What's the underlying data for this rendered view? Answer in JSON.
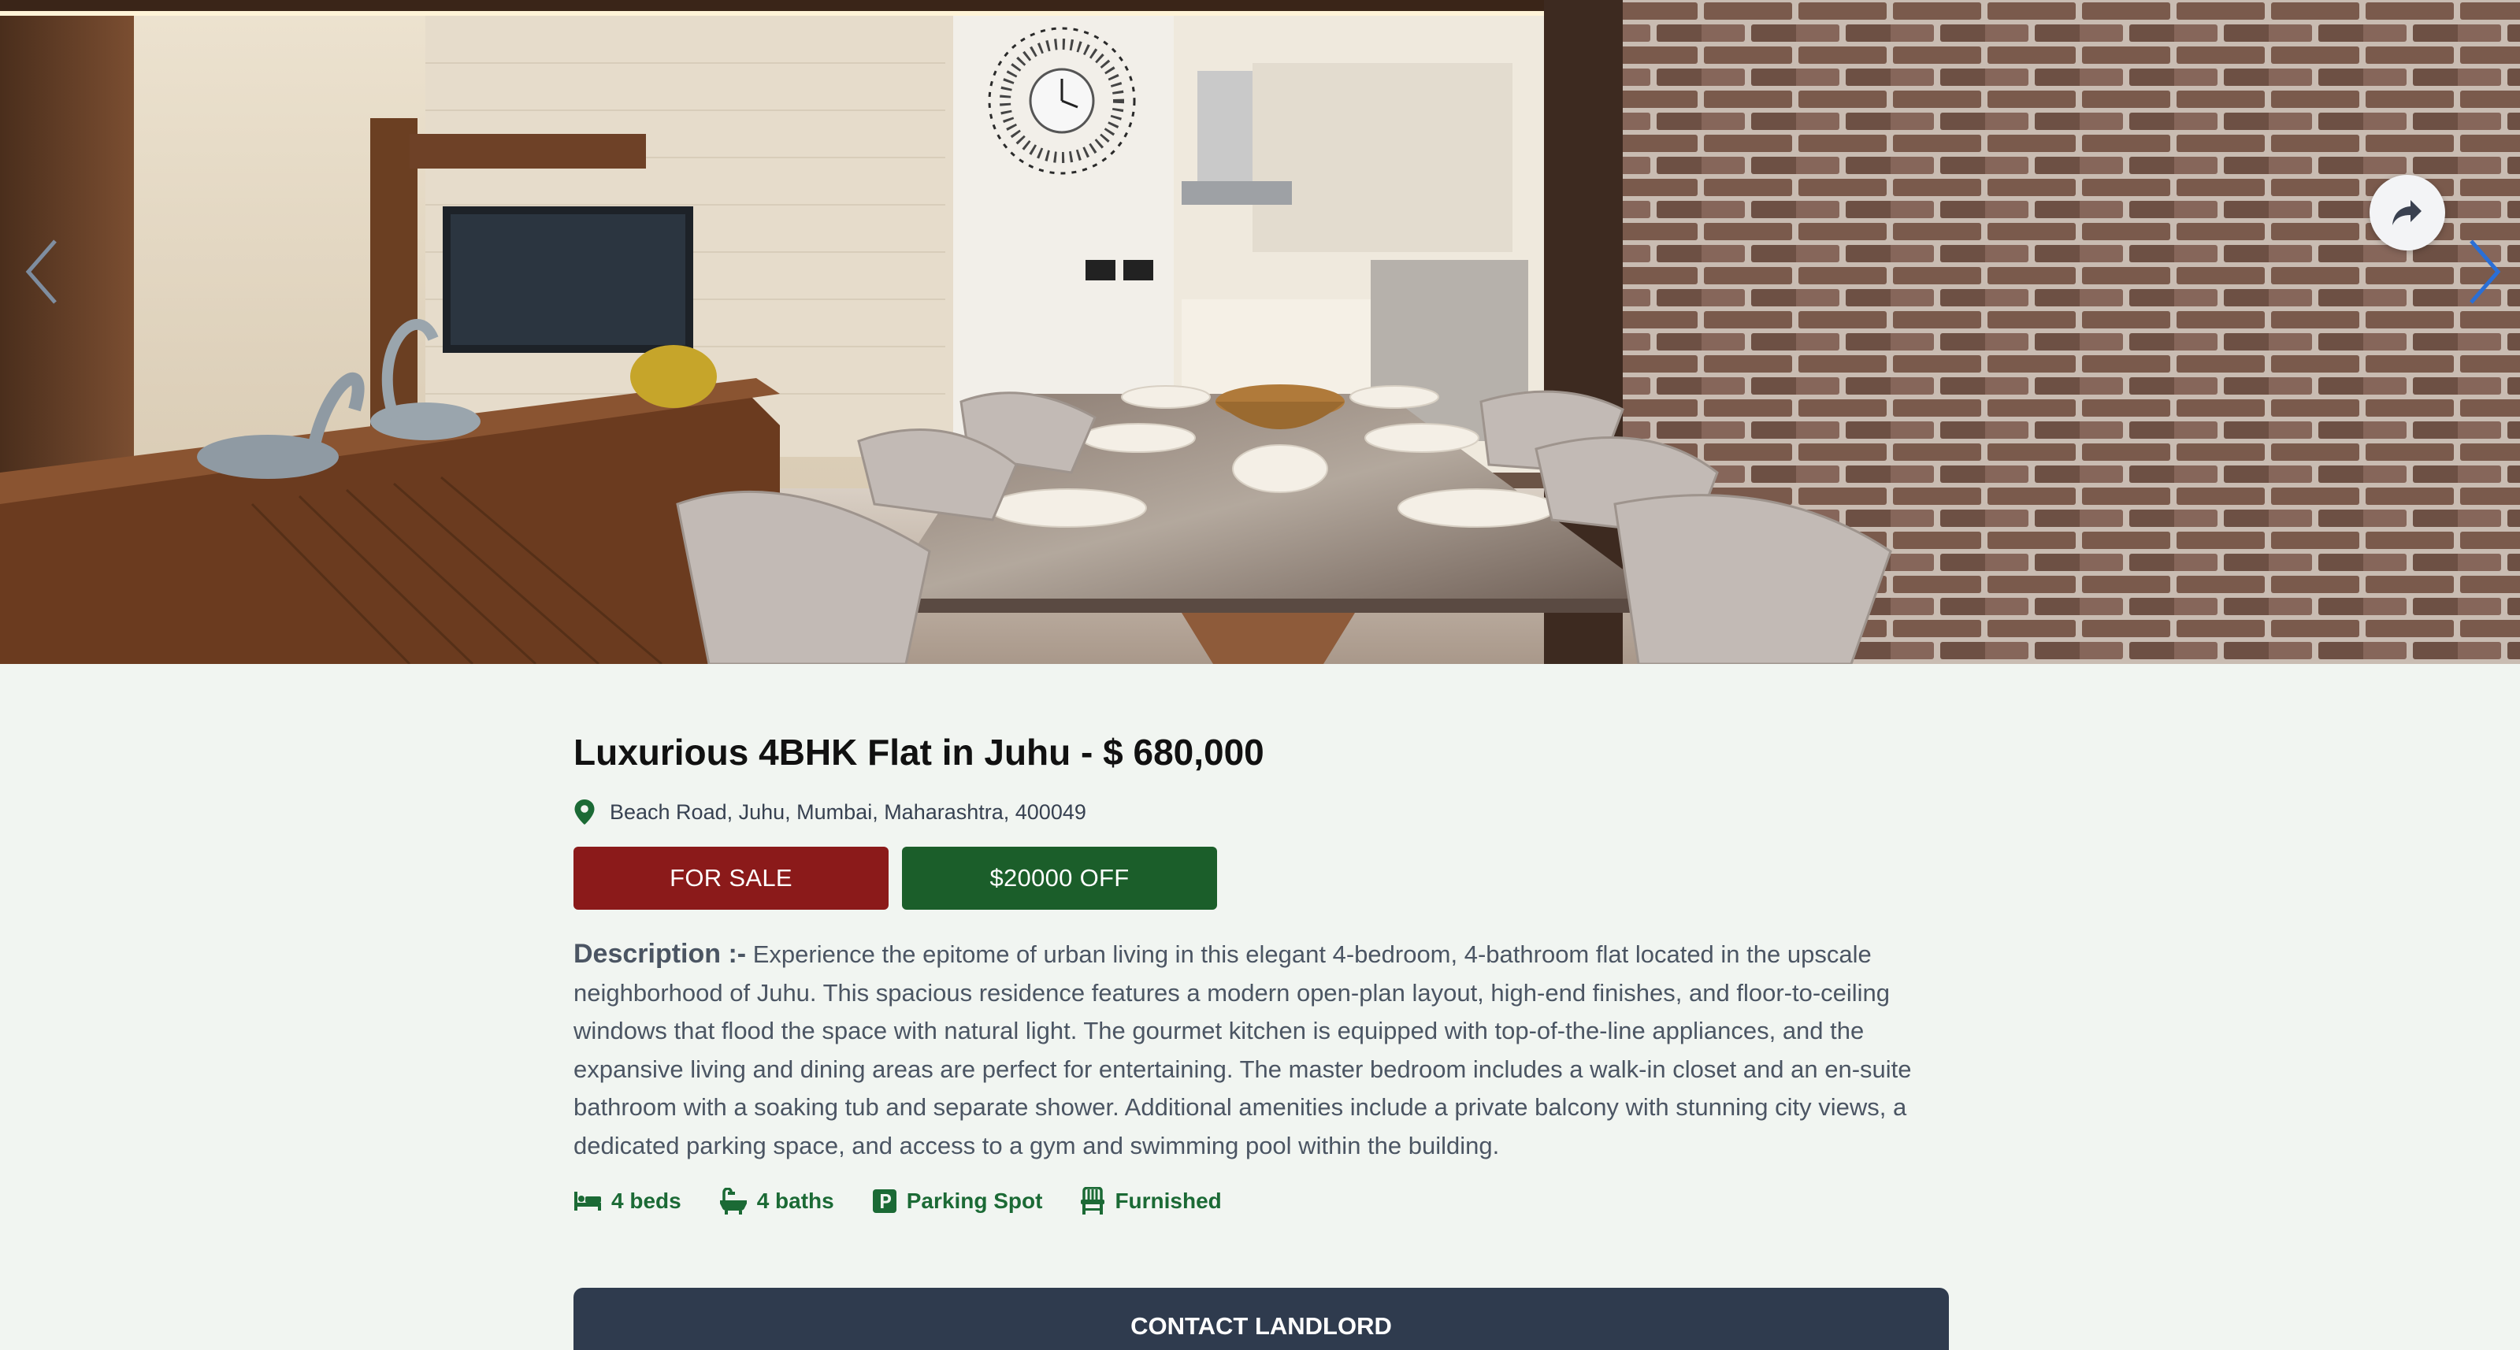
{
  "listing": {
    "title": "Luxurious 4BHK Flat in Juhu - $ 680,000",
    "address": "Beach Road, Juhu, Mumbai, Maharashtra, 400049",
    "status_badge": "FOR SALE",
    "discount_badge": "$20000 OFF",
    "description_label": "Description :-",
    "description": "Experience the epitome of urban living in this elegant 4-bedroom, 4-bathroom flat located in the upscale neighborhood of Juhu. This spacious residence features a modern open-plan layout, high-end finishes, and floor-to-ceiling windows that flood the space with natural light. The gourmet kitchen is equipped with top-of-the-line appliances, and the expansive living and dining areas are perfect for entertaining. The master bedroom includes a walk-in closet and an en-suite bathroom with a soaking tub and separate shower. Additional amenities include a private balcony with stunning city views, a dedicated parking space, and access to a gym and swimming pool within the building."
  },
  "features": [
    {
      "icon": "bed-icon",
      "label": "4 beds"
    },
    {
      "icon": "bathtub-icon",
      "label": "4 baths"
    },
    {
      "icon": "parking-icon",
      "label": "Parking Spot"
    },
    {
      "icon": "chair-icon",
      "label": "Furnished"
    }
  ],
  "actions": {
    "contact_label": "CONTACT LANDLORD"
  },
  "colors": {
    "page_background": "#f1f5f1",
    "sale_badge": "#8b1a1a",
    "discount_badge": "#1b5e2a",
    "feature_green": "#1b6a35",
    "contact_button": "#2f3b4e",
    "carousel_arrow": "#2a6fd6"
  },
  "icons": {
    "prev": "chevron-left-icon",
    "next": "chevron-right-icon",
    "share": "share-icon",
    "location": "location-pin-icon"
  }
}
